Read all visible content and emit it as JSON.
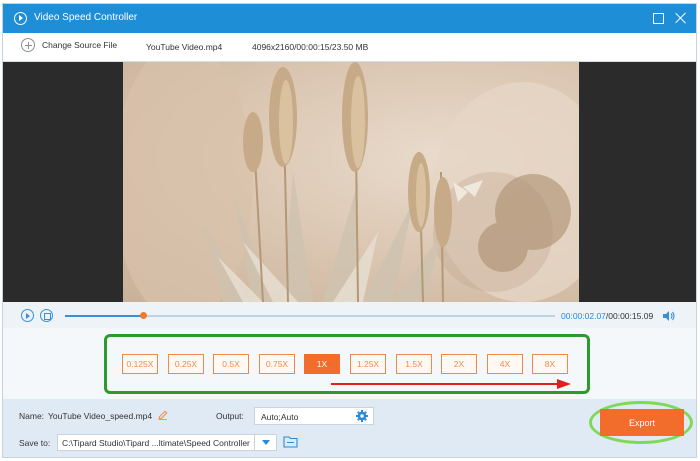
{
  "window": {
    "title": "Video Speed Controller"
  },
  "file_info": {
    "change_source_label": "Change Source File",
    "filename": "YouTube Video.mp4",
    "details": "4096x2160/00:00:15/23.50 MB"
  },
  "playback": {
    "current_time": "00:00:02.07",
    "total_time": "/00:00:15.09",
    "progress": 0.16
  },
  "speed": {
    "options": [
      "0.125X",
      "0.25X",
      "0.5X",
      "0.75X",
      "1X",
      "1.25X",
      "1.5X",
      "2X",
      "4X",
      "8X"
    ],
    "selected": "1X"
  },
  "output": {
    "name_label": "Name:",
    "name_value": "YouTube Video_speed.mp4",
    "output_label": "Output:",
    "output_value": "Auto;Auto",
    "save_label": "Save to:",
    "save_path": "C:\\Tipard Studio\\Tipard ...ltimate\\Speed Controller",
    "export_label": "Export"
  },
  "colors": {
    "accent": "#1e8ed6",
    "export": "#f26d2c",
    "highlight_box": "#2c9a2c",
    "highlight_ring": "#7ed957",
    "arrow": "#e02020"
  }
}
